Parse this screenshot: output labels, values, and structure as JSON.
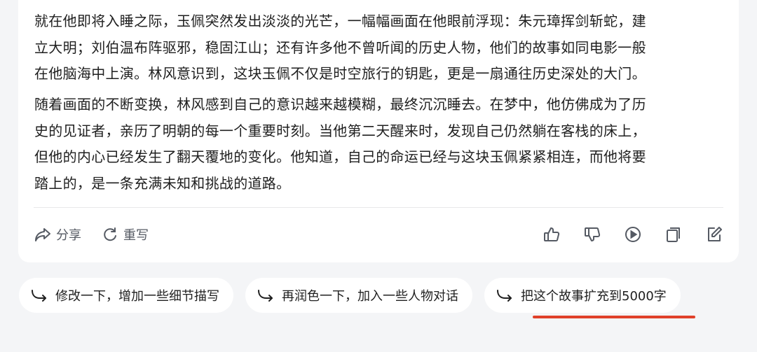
{
  "story": {
    "paragraph1": [
      "就在他即将入睡之际，玉佩突然发出淡淡的光芒，一幅幅画面在他眼前浮现：朱元璋挥剑斩蛇，建",
      "立大明；刘伯温布阵驱邪，稳固江山；还有许多他不曾听闻的历史人物，他们的故事如同电影一般",
      "在他脑海中上演。林风意识到，这块玉佩不仅是时空旅行的钥匙，更是一扇通往历史深处的大门。"
    ],
    "paragraph2": [
      "随着画面的不断变换，林风感到自己的意识越来越模糊，最终沉沉睡去。在梦中，他仿佛成为了历",
      "史的见证者，亲历了明朝的每一个重要时刻。当他第二天醒来时，发现自己仍然躺在客栈的床上，",
      "但他的内心已经发生了翻天覆地的变化。他知道，自己的命运已经与这块玉佩紧紧相连，而他将要",
      "踏上的，是一条充满未知和挑战的道路。"
    ]
  },
  "actions": {
    "share_label": "分享",
    "rewrite_label": "重写"
  },
  "icons": {
    "share": "share-icon",
    "rewrite": "refresh-icon",
    "like": "thumbs-up-icon",
    "dislike": "thumbs-down-icon",
    "play": "play-icon",
    "copy": "copy-icon",
    "edit": "edit-icon",
    "suggestion": "arrow-return-icon"
  },
  "suggestions": [
    {
      "label": "修改一下，增加一些细节描写"
    },
    {
      "label": "再润色一下，加入一些人物对话"
    },
    {
      "label": "把这个故事扩充到5000字"
    }
  ],
  "colors": {
    "accent_underline": "#e0412a",
    "background": "#f4f5f7"
  }
}
